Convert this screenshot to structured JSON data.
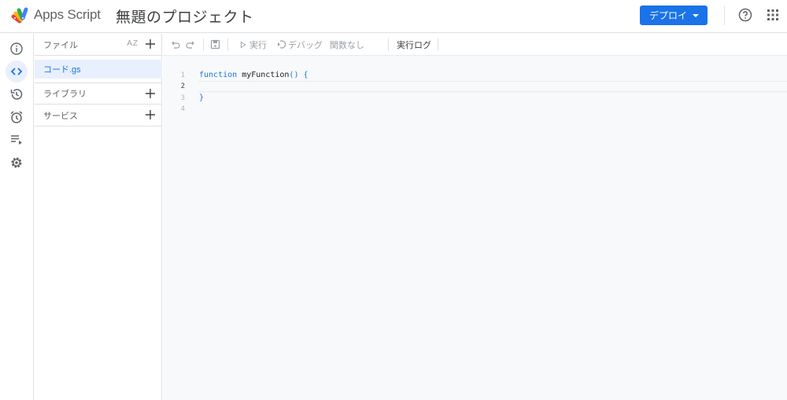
{
  "header": {
    "app_name": "Apps Script",
    "project_title": "無題のプロジェクト",
    "deploy_label": "デプロイ",
    "icons": [
      "apps-script-logo",
      "help-icon",
      "apps-grid-icon"
    ]
  },
  "rail": {
    "items": [
      {
        "name": "overview",
        "icon": "info-icon",
        "active": false
      },
      {
        "name": "editor",
        "icon": "code-icon",
        "active": true
      },
      {
        "name": "versions",
        "icon": "history-icon",
        "active": false
      },
      {
        "name": "triggers",
        "icon": "alarm-icon",
        "active": false
      },
      {
        "name": "executions",
        "icon": "playlist-play-icon",
        "active": false
      },
      {
        "name": "settings",
        "icon": "gear-icon",
        "active": false
      }
    ]
  },
  "files": {
    "files_label": "ファイル",
    "sort_label": "AZ",
    "file_name": "コード.gs",
    "libraries_label": "ライブラリ",
    "services_label": "サービス"
  },
  "toolbar": {
    "run_label": "実行",
    "debug_label": "デバッグ",
    "function_select": "関数なし",
    "log_label": "実行ログ"
  },
  "editor": {
    "lines": [
      {
        "number": "1",
        "keyword": "function",
        "name": "myFunction",
        "punct": "() {"
      },
      {
        "number": "2",
        "text": ""
      },
      {
        "number": "3",
        "punct": "}"
      },
      {
        "number": "4",
        "text": ""
      }
    ],
    "current_line": 2
  },
  "colors": {
    "accent": "#1a73e8",
    "active_bg": "#e8f0fe",
    "editor_bg": "#f8f9fa"
  }
}
